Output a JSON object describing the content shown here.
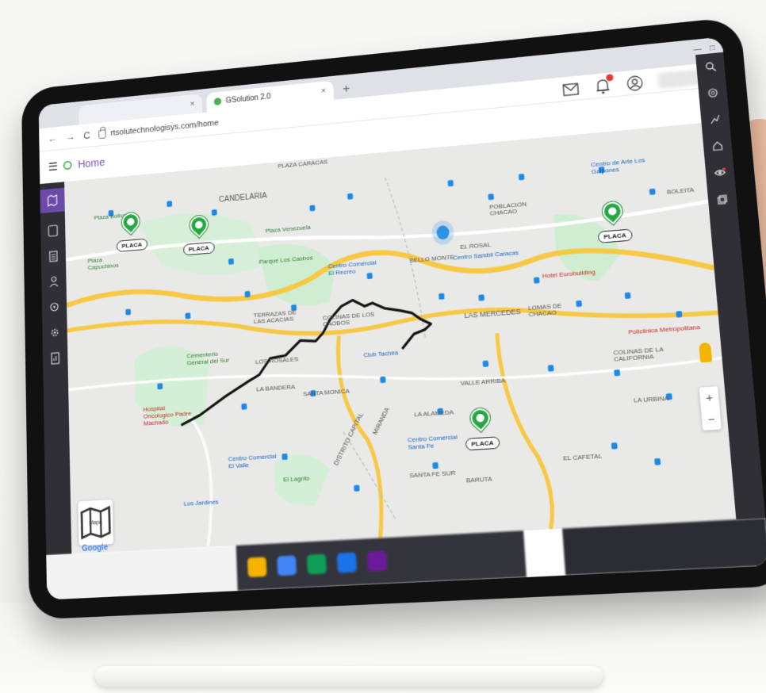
{
  "browser": {
    "tabs": [
      {
        "label": "",
        "close": "×"
      },
      {
        "label": "GSolution 2.0",
        "close": "×"
      }
    ],
    "new_tab": "+",
    "nav_back": "←",
    "nav_forward": "→",
    "reload": "C",
    "url": "rtsolutechnologisys.com/home"
  },
  "app": {
    "menu_icon": "☰",
    "title": "Home"
  },
  "map": {
    "labels": [
      {
        "text": "Plaza Caracas"
      },
      {
        "text": "Candelaria"
      },
      {
        "text": "Poblacion Chacao"
      },
      {
        "text": "Boleita"
      },
      {
        "text": "Terrazas de las Acacias"
      },
      {
        "text": "Colinas de los Caobos"
      },
      {
        "text": "Bello Monte"
      },
      {
        "text": "El Rosal"
      },
      {
        "text": "Las Mercedes"
      },
      {
        "text": "Lomas de Chacao"
      },
      {
        "text": "Los Rosales"
      },
      {
        "text": "Santa Monica"
      },
      {
        "text": "La Bandera"
      },
      {
        "text": "Valle Arriba"
      },
      {
        "text": "Colinas de la California"
      },
      {
        "text": "La Urbina"
      },
      {
        "text": "La Alameda"
      },
      {
        "text": "Santa Fe Sur"
      },
      {
        "text": "Distrito Capital"
      },
      {
        "text": "Miranda"
      },
      {
        "text": "Baruta"
      },
      {
        "text": "El Cafetal"
      }
    ],
    "pois": [
      {
        "text": "Plaza Bolivar",
        "tone": "green"
      },
      {
        "text": "Plaza Capuchinos",
        "tone": "green"
      },
      {
        "text": "Plaza Venezuela",
        "tone": "green"
      },
      {
        "text": "Centro Comercial El Recreo",
        "tone": "blue"
      },
      {
        "text": "Centro Sambil Caracas",
        "tone": "blue"
      },
      {
        "text": "Parque Los Caobos",
        "tone": "green"
      },
      {
        "text": "Hotel Eurobuilding",
        "tone": "red"
      },
      {
        "text": "Hospital Oncologico Padre Machado",
        "tone": "red"
      },
      {
        "text": "Centro Comercial Santa Fe",
        "tone": "blue"
      },
      {
        "text": "Centro Comercial El Valle",
        "tone": "blue"
      },
      {
        "text": "Cementerio General del Sur",
        "tone": "green"
      },
      {
        "text": "Club Tachira",
        "tone": "blue"
      },
      {
        "text": "El Lagrito",
        "tone": "green"
      },
      {
        "text": "Los Jardines",
        "tone": "blue"
      },
      {
        "text": "Policlinica Metropolitana",
        "tone": "red"
      },
      {
        "text": "Centro de Arte Los Galpones",
        "tone": "blue"
      }
    ],
    "markers": [
      "PLACA",
      "PLACA",
      "PLACA",
      "PLACA"
    ],
    "map_type_label": "Mapa",
    "google_logo": "Google",
    "zoom_in": "+",
    "zoom_out": "−"
  },
  "colors": {
    "accent": "#7a55b8",
    "sidebar": "#2f2f35",
    "marker": "#25a744",
    "route": "#111111"
  }
}
